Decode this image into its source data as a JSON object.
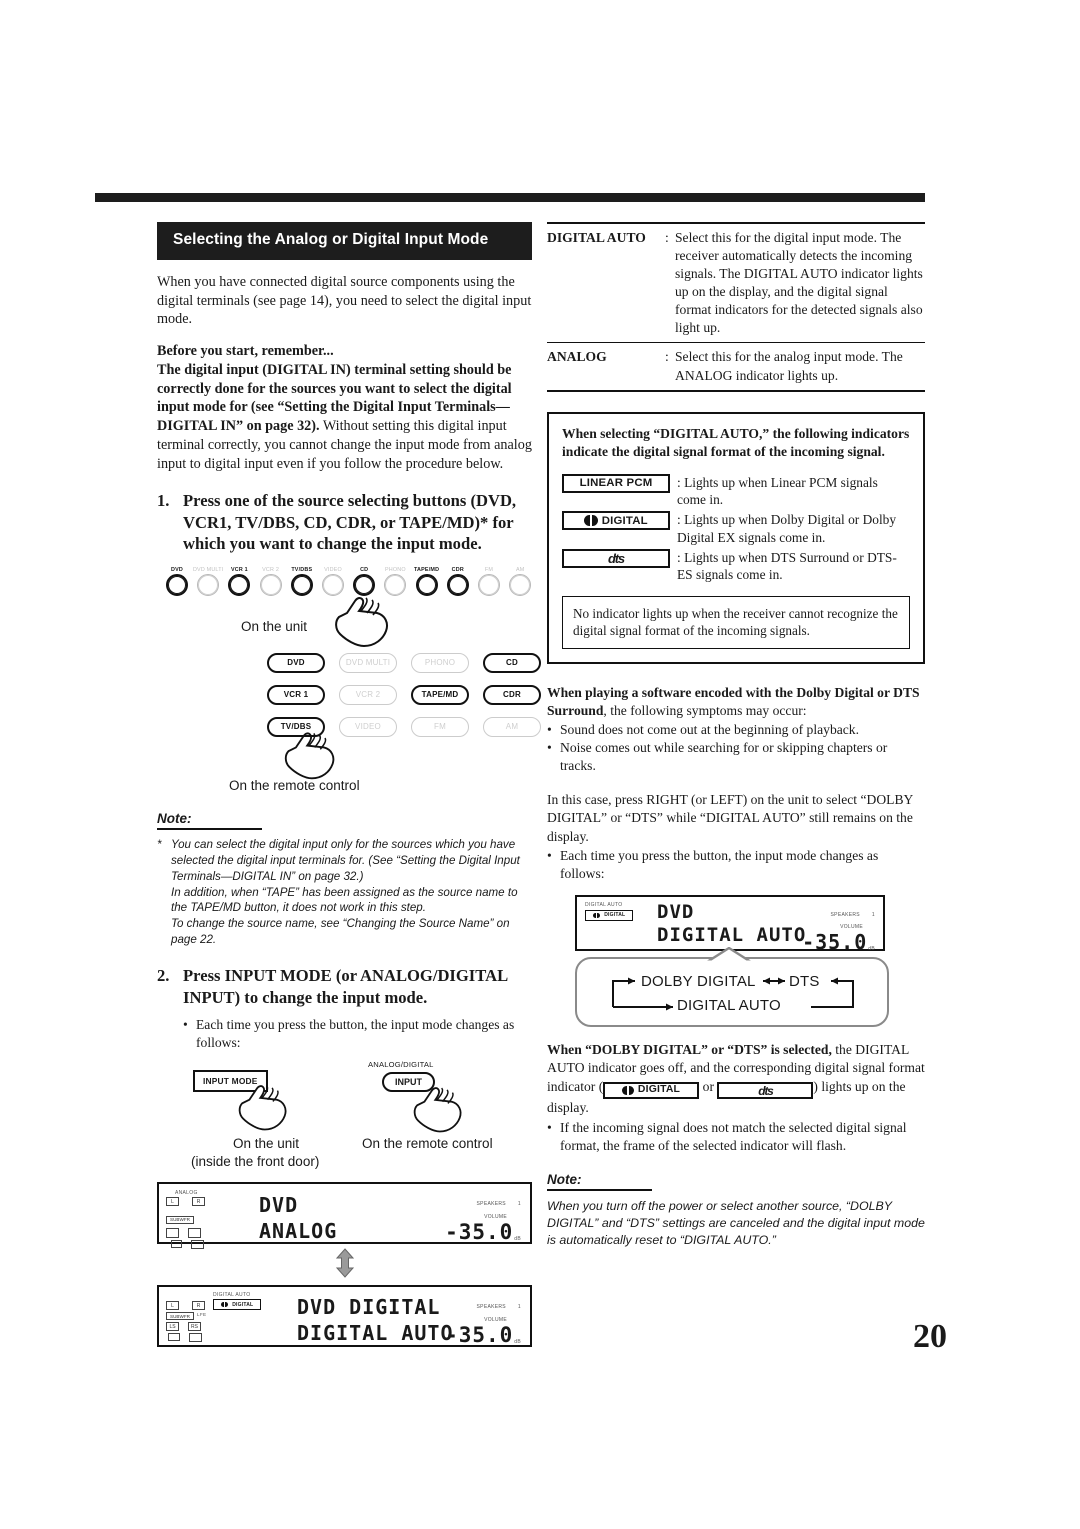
{
  "page_number": "20",
  "left": {
    "section_title": "Selecting the Analog or Digital Input Mode",
    "intro": "When you have connected digital source components using the digital terminals (see page 14), you need to select the digital input mode.",
    "before_heading": "Before you start, remember...",
    "before_bold": "The digital input (DIGITAL IN) terminal setting should be correctly done for the sources you want to select the digital input mode for (see “Setting the Digital Input Terminals—DIGITAL IN” on page 32).",
    "before_rest": " Without setting this digital input terminal correctly, you cannot change the input mode from analog input to digital input even if you follow the procedure below.",
    "step1_num": "1.",
    "step1_text": "Press one of the source selecting buttons (DVD, VCR1, TV/DBS, CD, CDR, or TAPE/MD)* for which you want to change the input mode.",
    "unit_buttons": [
      {
        "label": "DVD",
        "active": true
      },
      {
        "label": "DVD MULTI",
        "active": false
      },
      {
        "label": "VCR 1",
        "active": true
      },
      {
        "label": "VCR 2",
        "active": false
      },
      {
        "label": "TV/DBS",
        "active": true
      },
      {
        "label": "VIDEO",
        "active": false
      },
      {
        "label": "CD",
        "active": true
      },
      {
        "label": "PHONO",
        "active": false
      },
      {
        "label": "TAPE/MD",
        "active": true
      },
      {
        "label": "CDR",
        "active": true
      },
      {
        "label": "FM",
        "active": false
      },
      {
        "label": "AM",
        "active": false
      }
    ],
    "caption_unit": "On the unit",
    "remote_buttons": [
      {
        "label": "DVD",
        "active": true
      },
      {
        "label": "DVD MULTI",
        "active": false
      },
      {
        "label": "PHONO",
        "active": false
      },
      {
        "label": "CD",
        "active": true
      },
      {
        "label": "VCR 1",
        "active": true
      },
      {
        "label": "VCR 2",
        "active": false
      },
      {
        "label": "TAPE/MD",
        "active": true
      },
      {
        "label": "CDR",
        "active": true
      },
      {
        "label": "TV/DBS",
        "active": true
      },
      {
        "label": "VIDEO",
        "active": false
      },
      {
        "label": "FM",
        "active": false
      },
      {
        "label": "AM",
        "active": false
      }
    ],
    "caption_remote": "On the remote control",
    "note_heading": "Note:",
    "note_star": "*",
    "note_p1": "You can select the digital input only for the sources which you have selected the digital input terminals for. (See “Setting the Digital Input Terminals—DIGITAL IN” on page 32.)",
    "note_p2": "In addition, when “TAPE” has been assigned as the source name to the TAPE/MD button, it does not work in this step.",
    "note_p3": "To change the source name, see “Changing the Source Name” on page 22.",
    "step2_num": "2.",
    "step2_text": "Press INPUT MODE (or ANALOG/DIGITAL INPUT) to change the input mode.",
    "step2_bullet": "Each time you press the button, the input mode changes as follows:",
    "input_mode_button": "INPUT MODE",
    "analog_digital_label": "ANALOG/DIGITAL",
    "input_button": "INPUT",
    "caption_unit2_line1": "On the unit",
    "caption_unit2_line2": "(inside the front door)",
    "caption_remote2": "On the remote control",
    "lcd1": {
      "indicator_label": "ANALOG",
      "boxes": [
        "L",
        "R",
        "SUBWFR"
      ],
      "line1": "DVD",
      "line2": "ANALOG",
      "speakers_label": "SPEAKERS",
      "speakers_value": "1",
      "volume_label": "VOLUME",
      "volume": "-35.0",
      "volume_unit": "dB"
    },
    "lcd2": {
      "indicator_label": "DIGITAL AUTO",
      "format_indicator": "DIGITAL",
      "boxes": [
        "L",
        "R",
        "SUBWFR",
        "LFE",
        "LS",
        "RS"
      ],
      "line1": "DVD DIGITAL",
      "line2": "DIGITAL AUTO",
      "speakers_label": "SPEAKERS",
      "speakers_value": "1",
      "volume_label": "VOLUME",
      "volume": "-35.0",
      "volume_unit": "dB"
    }
  },
  "right": {
    "table": [
      {
        "key": "DIGITAL AUTO",
        "colon": ":",
        "value": "Select this for the digital input mode. The receiver automatically detects the incoming signals. The DIGITAL AUTO indicator lights up on the display, and the digital signal format indicators for the detected signals also light up."
      },
      {
        "key": "ANALOG",
        "colon": ":",
        "value": "Select this for the analog input mode. The ANALOG indicator lights up."
      }
    ],
    "indicator_box_heading": "When selecting “DIGITAL AUTO,” the following indicators indicate the digital signal format of the incoming signal.",
    "indicators": [
      {
        "name": "LINEAR PCM",
        "type": "text",
        "desc": ": Lights up when Linear PCM signals come in."
      },
      {
        "name": "DIGITAL",
        "type": "dolby",
        "desc": ": Lights up when Dolby Digital or Dolby Digital EX signals come in."
      },
      {
        "name": "dts",
        "type": "dts",
        "desc": ": Lights up when DTS Surround or DTS-ES signals come in."
      }
    ],
    "no_indicator_note": "No indicator lights up when the receiver cannot recognize the digital signal format of the incoming signals.",
    "dolby_heading_bold": "When playing a software encoded with the Dolby Digital or DTS Surround",
    "dolby_heading_rest": ", the following symptoms may occur:",
    "symptoms": [
      "Sound does not come out at the beginning of playback.",
      "Noise comes out while searching for or skipping chapters or tracks."
    ],
    "in_this_case": "In this case, press RIGHT (or LEFT) on the unit to select “DOLBY DIGITAL” or “DTS” while “DIGITAL AUTO” still remains on the display.",
    "in_this_case_underline": "on the unit",
    "each_time_bullet": "Each time you press the button, the input mode changes as follows:",
    "lcd3": {
      "indicator_label": "DIGITAL AUTO",
      "format_indicator": "DIGITAL",
      "line1": "DVD",
      "line2": "DIGITAL AUTO",
      "speakers_label": "SPEAKERS",
      "speakers_value": "1",
      "volume_label": "VOLUME",
      "volume": "-35.0",
      "volume_unit": "dB"
    },
    "cycle": {
      "item1": "DOLBY DIGITAL",
      "item2": "DTS",
      "item3": "DIGITAL AUTO"
    },
    "when_dolby_bold": "When “DOLBY DIGITAL” or “DTS” is selected,",
    "when_dolby_rest1": " the DIGITAL AUTO indicator goes off, and the corresponding digital signal format indicator (",
    "when_dolby_ind1": "DIGITAL",
    "when_dolby_or": "or",
    "when_dolby_ind2": "dts",
    "when_dolby_rest2": ") lights up on the display.",
    "when_dolby_bullet": "If the incoming signal does not match the selected digital signal format, the frame of the selected indicator will flash.",
    "note_heading": "Note:",
    "note_body": "When you turn off the power or select another source, “DOLBY DIGITAL” and “DTS” settings are canceled and the digital input mode is automatically reset to “DIGITAL AUTO.”"
  }
}
